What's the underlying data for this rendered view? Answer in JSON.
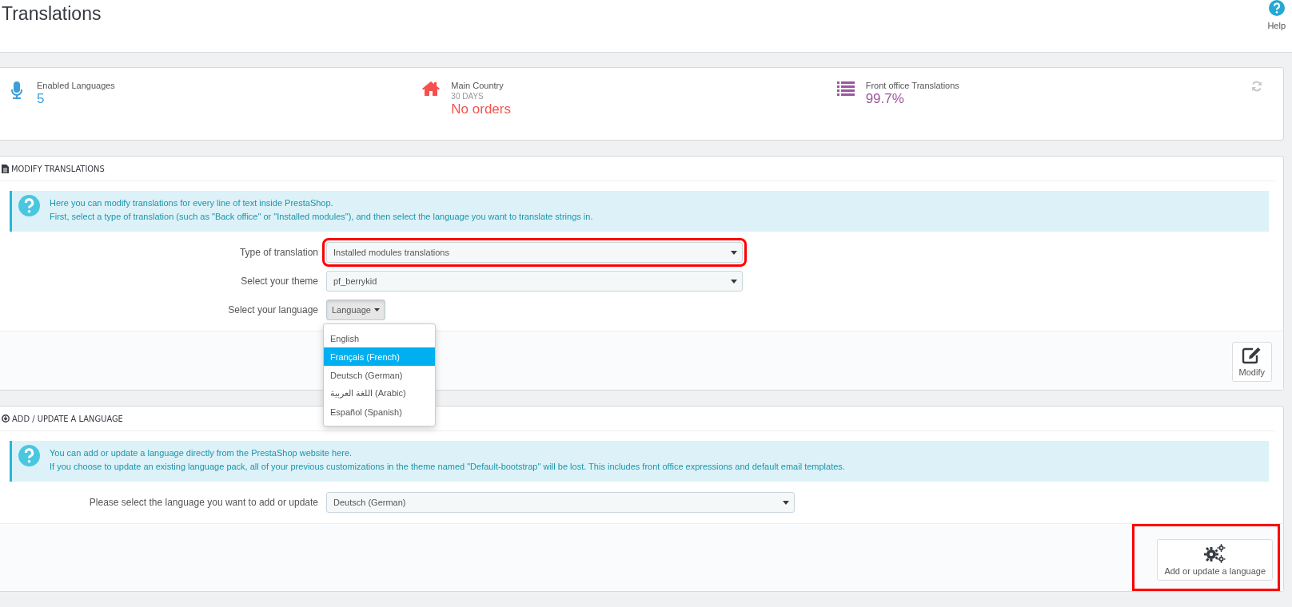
{
  "page": {
    "title": "Translations",
    "help": {
      "label": "Help"
    }
  },
  "kpis": [
    {
      "kind": "mic",
      "label": "Enabled Languages",
      "value": "5",
      "color": "#3ba0d9"
    },
    {
      "kind": "house",
      "label": "Main Country",
      "sub": "30 DAYS",
      "value": "No orders",
      "color": "#f5504d"
    },
    {
      "kind": "list",
      "label": "Front office Translations",
      "value": "99.7%",
      "color": "#9c56a0"
    }
  ],
  "panels": [
    {
      "kind": "modify",
      "title": "MODIFY TRANSLATIONS",
      "alert": [
        "Here you can modify translations for every line of text inside PrestaShop.",
        "First, select a type of translation (such as \"Back office\" or \"Installed modules\"), and then select the language you want to translate strings in."
      ],
      "fields": [
        {
          "kind": "select",
          "label": "Type of translation",
          "value": "Installed modules translations",
          "highlighted": true
        },
        {
          "kind": "select",
          "label": "Select your theme",
          "value": "pf_berrykid",
          "highlighted": false
        },
        {
          "kind": "dropdown",
          "label": "Select your language",
          "value": "Language",
          "expanded": true,
          "options": [
            {
              "label": "English",
              "selected": false
            },
            {
              "label": "Français (French)",
              "selected": true
            },
            {
              "label": "Deutsch (German)",
              "selected": false
            },
            {
              "label": "اللغة العربية (Arabic)",
              "selected": false
            },
            {
              "label": "Español (Spanish)",
              "selected": false
            }
          ]
        }
      ],
      "button": {
        "label": "Modify",
        "highlighted": false
      }
    },
    {
      "kind": "add",
      "title": "ADD / UPDATE A LANGUAGE",
      "alert": [
        "You can add or update a language directly from the PrestaShop website here.",
        "If you choose to update an existing language pack, all of your previous customizations in the theme named \"Default-bootstrap\" will be lost. This includes front office expressions and default email templates."
      ],
      "fields": [
        {
          "kind": "select",
          "label": "Please select the language you want to add or update",
          "value": "Deutsch (German)",
          "highlighted": false
        }
      ],
      "button": {
        "label": "Add or update a language",
        "highlighted": true
      }
    }
  ]
}
